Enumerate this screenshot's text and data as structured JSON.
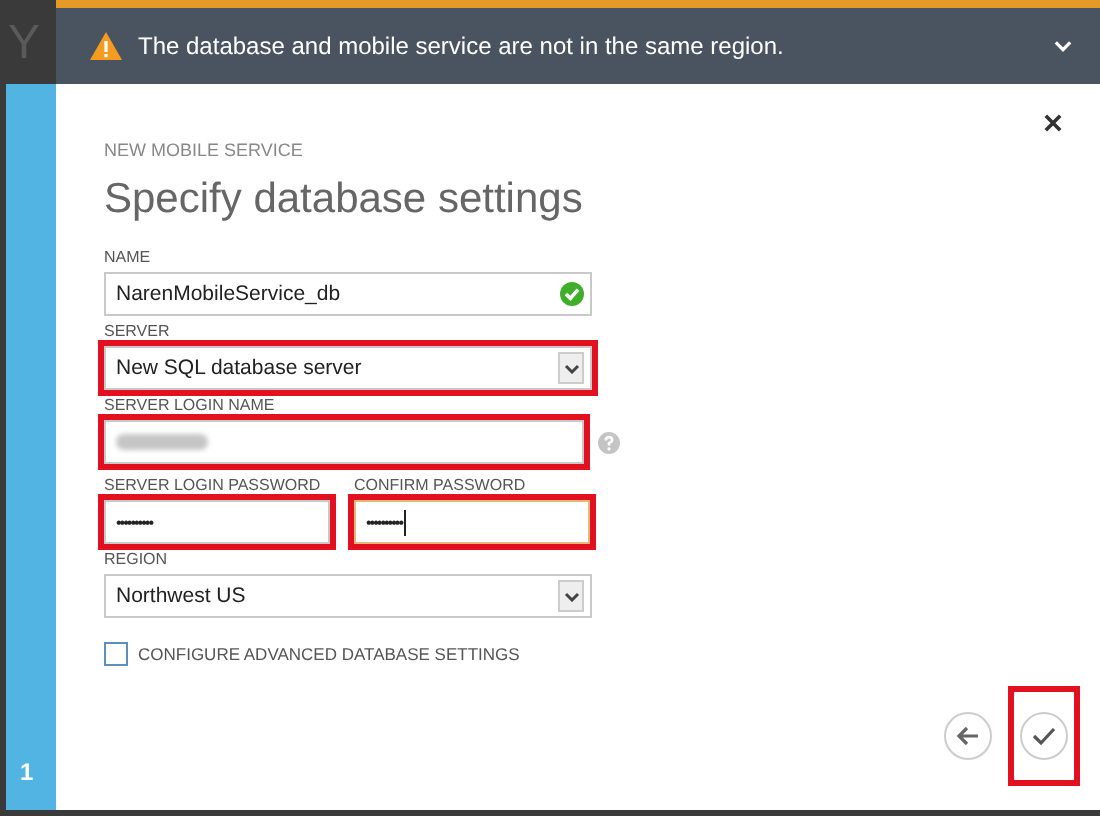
{
  "background": {
    "heading_fragment": "Y"
  },
  "notification": {
    "message": "The database and mobile service are not in the same region."
  },
  "wizard": {
    "subtitle": "NEW MOBILE SERVICE",
    "title": "Specify database settings",
    "step": "1"
  },
  "fields": [
    {
      "kind": "text",
      "label": "NAME",
      "value": "NarenMobileService_db",
      "valid": true,
      "highlighted": false
    },
    {
      "kind": "select",
      "label": "SERVER",
      "value": "New SQL database server",
      "highlighted": true
    },
    {
      "kind": "redacted",
      "label": "SERVER LOGIN NAME",
      "help": true,
      "highlighted": true
    }
  ],
  "password_fields": [
    {
      "label": "SERVER LOGIN PASSWORD",
      "value": "••••••••••",
      "focused": false,
      "highlighted": true
    },
    {
      "label": "CONFIRM PASSWORD",
      "value": "••••••••••",
      "focused": true,
      "highlighted": true
    }
  ],
  "region": {
    "kind": "select",
    "label": "REGION",
    "value": "Northwest US",
    "highlighted": false
  },
  "advanced": {
    "label": "CONFIGURE ADVANCED DATABASE SETTINGS",
    "checked": false
  },
  "nav": {
    "back_highlighted": false,
    "finish_highlighted": true
  }
}
